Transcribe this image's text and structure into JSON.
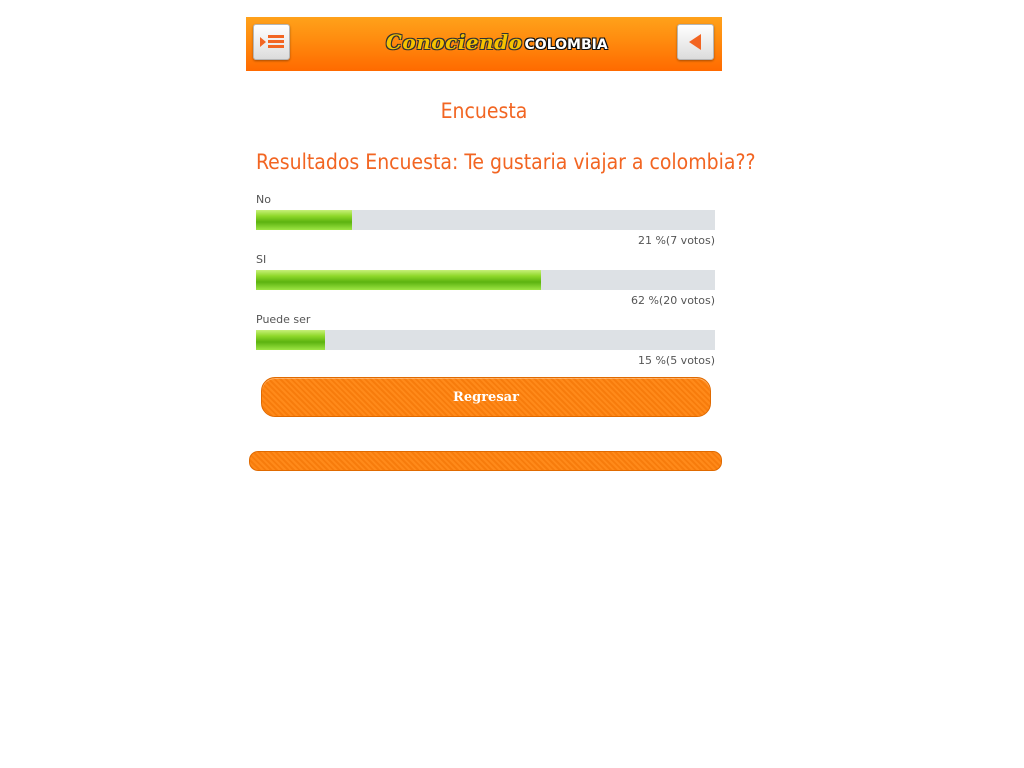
{
  "header": {
    "logo_script": "Conociendo",
    "logo_word": "COLOMBIA"
  },
  "page": {
    "title": "Encuesta",
    "question": "Resultados Encuesta: Te gustaria viajar a colombia??"
  },
  "poll": {
    "options": [
      {
        "label": "No",
        "percent": 21,
        "result": "21 %(7 votos)"
      },
      {
        "label": "SI",
        "percent": 62,
        "result": "62 %(20 votos)"
      },
      {
        "label": "Puede ser",
        "percent": 15,
        "result": "15 %(5 votos)"
      }
    ]
  },
  "actions": {
    "back_label": "Regresar"
  },
  "colors": {
    "accent": "#f26522",
    "bar_fill": "#6cc21a",
    "bar_track": "#dde1e5"
  },
  "icons": {
    "menu": "menu-icon",
    "back": "back-arrow-icon"
  }
}
